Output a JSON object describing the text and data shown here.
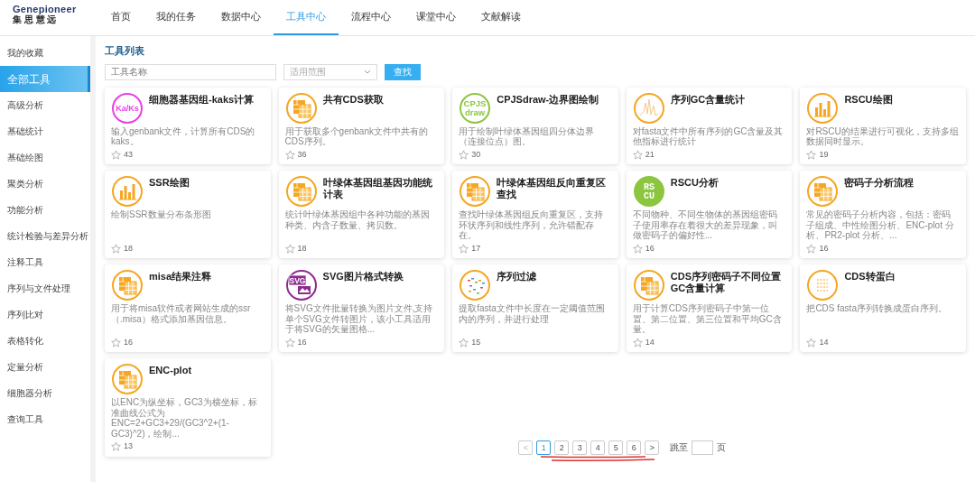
{
  "logo": {
    "wordmark": "Genepioneer",
    "slogan": "集 思 慧 远"
  },
  "nav": [
    {
      "label": "首页",
      "selected": false
    },
    {
      "label": "我的任务",
      "selected": false
    },
    {
      "label": "数据中心",
      "selected": false
    },
    {
      "label": "工具中心",
      "selected": true
    },
    {
      "label": "流程中心",
      "selected": false
    },
    {
      "label": "课堂中心",
      "selected": false
    },
    {
      "label": "文献解读",
      "selected": false
    }
  ],
  "sidebar": {
    "items": [
      {
        "label": "我的收藏",
        "selected": false
      },
      {
        "label": "全部工具",
        "selected": true
      },
      {
        "label": "高级分析",
        "selected": false
      },
      {
        "label": "基础统计",
        "selected": false
      },
      {
        "label": "基础绘图",
        "selected": false
      },
      {
        "label": "聚类分析",
        "selected": false
      },
      {
        "label": "功能分析",
        "selected": false
      },
      {
        "label": "统计检验与差异分析",
        "selected": false
      },
      {
        "label": "注释工具",
        "selected": false
      },
      {
        "label": "序列与文件处理",
        "selected": false
      },
      {
        "label": "序列比对",
        "selected": false
      },
      {
        "label": "表格转化",
        "selected": false
      },
      {
        "label": "定量分析",
        "selected": false
      },
      {
        "label": "细胞器分析",
        "selected": false
      },
      {
        "label": "查询工具",
        "selected": false
      }
    ]
  },
  "section_title": "工具列表",
  "search": {
    "placeholder": "工具名称",
    "scope_placeholder": "适用范围",
    "button": "查找"
  },
  "tools": [
    {
      "title": "细胞器基因组-kaks计算",
      "description": "输入genbank文件，计算所有CDS的kaks。",
      "count": "43",
      "icon": {
        "kind": "text",
        "color": "#e93fe6",
        "lines": [
          "Ka/Ks"
        ]
      }
    },
    {
      "title": "共有CDS获取",
      "description": "用于获取多个genbank文件中共有的CDS序列。",
      "count": "36",
      "icon": {
        "kind": "sheet",
        "color": "#f5a623"
      }
    },
    {
      "title": "CPJSdraw-边界图绘制",
      "description": "用于绘制叶绿体基因组四分体边界（连接位点）图。",
      "count": "30",
      "icon": {
        "kind": "text",
        "color": "#8cc63f",
        "lines": [
          "CPJS",
          "draw"
        ]
      }
    },
    {
      "title": "序列GC含量统计",
      "description": "对fasta文件中所有序列的GC含量及其他指标进行统计",
      "count": "21",
      "icon": {
        "kind": "peaks",
        "color": "#f5a623"
      }
    },
    {
      "title": "RSCU绘图",
      "description": "对RSCU的结果进行可视化，支持多组数据同时显示。",
      "count": "19",
      "icon": {
        "kind": "bars",
        "color": "#f5a623"
      }
    },
    {
      "title": "SSR绘图",
      "description": "绘制SSR数量分布条形图",
      "count": "18",
      "icon": {
        "kind": "bars",
        "color": "#f5a623"
      }
    },
    {
      "title": "叶绿体基因组基因功能统计表",
      "description": "统计叶绿体基因组中各种功能的基因种类、内含子数量、拷贝数。",
      "count": "18",
      "icon": {
        "kind": "sheet",
        "color": "#f5a623"
      }
    },
    {
      "title": "叶绿体基因组反向重复区查找",
      "description": "查找叶绿体基因组反向重复区，支持环状序列和线性序列，允许错配存在。",
      "count": "17",
      "icon": {
        "kind": "sheet",
        "color": "#f5a623"
      }
    },
    {
      "title": "RSCU分析",
      "description": "不同物种、不同生物体的基因组密码子使用率存在着很大的差异现象，叫做密码子的偏好性...",
      "count": "16",
      "icon": {
        "kind": "block",
        "color": "#8cc63f",
        "lines": [
          "RS",
          "CU"
        ]
      }
    },
    {
      "title": "密码子分析流程",
      "description": "常见的密码子分析内容，包括：密码子组成、中性绘图分析、ENC-plot 分析、PR2-plot 分析、...",
      "count": "16",
      "icon": {
        "kind": "sheet",
        "color": "#f5a623"
      }
    },
    {
      "title": "misa结果注释",
      "description": "用于将misa软件或者网站生成的ssr（.misa）格式添加基因信息。",
      "count": "16",
      "icon": {
        "kind": "sheet",
        "color": "#f5a623"
      }
    },
    {
      "title": "SVG图片格式转换",
      "description": "将SVG文件批量转换为图片文件,支持单个SVG文件转图片，该小工具适用于将SVG的矢量图格...",
      "count": "16",
      "icon": {
        "kind": "svg",
        "color": "#8e2a8e",
        "lines": [
          "SVG"
        ]
      }
    },
    {
      "title": "序列过滤",
      "description": "提取fasta文件中长度在一定阈值范围内的序列，并进行处理",
      "count": "15",
      "icon": {
        "kind": "dots",
        "color": "#f5a623"
      }
    },
    {
      "title": "CDS序列密码子不同位置GC含量计算",
      "description": "用于计算CDS序列密码子中第一位置、第二位置、第三位置和平均GC含量。",
      "count": "14",
      "icon": {
        "kind": "sheet",
        "color": "#f5a623"
      }
    },
    {
      "title": "CDS转蛋白",
      "description": "把CDS fasta序列转换成蛋白序列。",
      "count": "14",
      "icon": {
        "kind": "protein",
        "color": "#f5a623"
      }
    },
    {
      "title": "ENC-plot",
      "description": "以ENC为纵坐标，GC3为横坐标，标准曲线公式为ENC=2+GC3+29/(GC3^2+(1-GC3)^2)，绘制...",
      "count": "13",
      "icon": {
        "kind": "sheet",
        "color": "#f5a623"
      }
    }
  ],
  "pagination": {
    "prev": "<",
    "next": ">",
    "pages": [
      {
        "label": "1",
        "selected": true
      },
      {
        "label": "2",
        "selected": false
      },
      {
        "label": "3",
        "selected": false
      },
      {
        "label": "4",
        "selected": false
      },
      {
        "label": "5",
        "selected": false
      },
      {
        "label": "6",
        "selected": false
      }
    ],
    "jump_label": "跳至",
    "page_suffix": "页",
    "marked": true
  }
}
